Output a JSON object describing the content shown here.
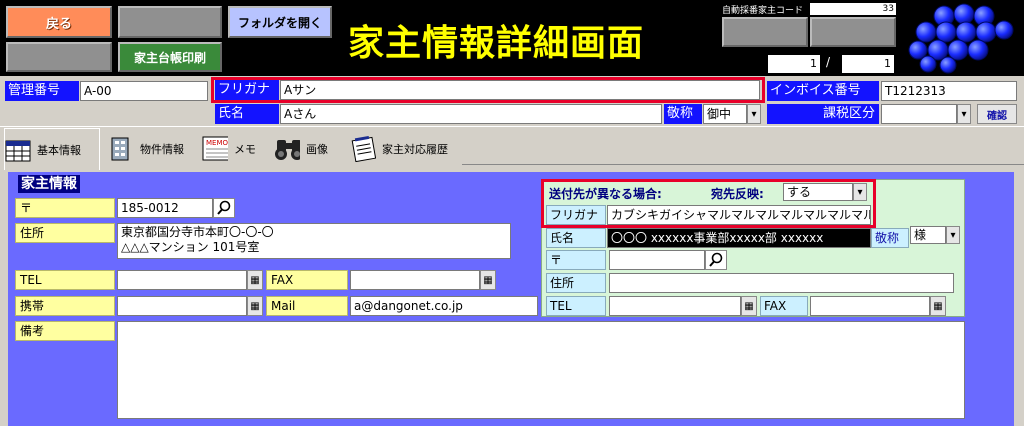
{
  "header": {
    "back_label": "戻る",
    "folder_label": "フォルダを開く",
    "print_label": "家主台帳印刷",
    "title": "家主情報詳細画面",
    "auto_code_label": "自動採番家主コード",
    "auto_code_value": "33",
    "record_current": "1",
    "record_separator": "/",
    "record_total": "1"
  },
  "top": {
    "management_no_label": "管理番号",
    "management_no_value": "A-00",
    "furigana_label": "フリガナ",
    "furigana_value": "Aサン",
    "name_label": "氏名",
    "name_value": "Aさん",
    "honorific_label": "敬称",
    "honorific_value": "御中",
    "invoice_label": "インボイス番号",
    "invoice_value": "T1212313",
    "tax_label": "課税区分",
    "tax_value": "",
    "confirm_label": "確認"
  },
  "tabs": [
    {
      "label": "基本情報",
      "icon": "calendar-icon"
    },
    {
      "label": "物件情報",
      "icon": "building-icon"
    },
    {
      "label": "メモ",
      "icon": "memo-icon"
    },
    {
      "label": "画像",
      "icon": "binoculars-icon"
    },
    {
      "label": "家主対応履歴",
      "icon": "notepad-icon"
    }
  ],
  "panel": {
    "section_title": "家主情報",
    "zip_label": "〒",
    "zip_value": "185-0012",
    "address_label": "住所",
    "address_line1": "東京都国分寺市本町〇-〇-〇",
    "address_line2": "△△△マンション 101号室",
    "tel_label": "TEL",
    "tel_value": "",
    "fax_label": "FAX",
    "fax_value": "",
    "mobile_label": "携帯",
    "mobile_value": "",
    "mail_label": "Mail",
    "mail_value": "a@dangonet.co.jp",
    "notes_label": "備考",
    "notes_value": ""
  },
  "alt_dest": {
    "header_label": "送付先が異なる場合:",
    "reflect_label": "宛先反映:",
    "reflect_value": "する",
    "furigana_label": "フリガナ",
    "furigana_value": "カブシキガイシャマルマルマルマルマルマルマル",
    "name_label": "氏名",
    "name_value": "〇〇〇 xxxxxx事業部xxxxx部 xxxxxx",
    "honorific_label": "敬称",
    "honorific_value": "様",
    "zip_label": "〒",
    "zip_value": "",
    "address_label": "住所",
    "address_value": "",
    "tel_label": "TEL",
    "tel_value": "",
    "fax_label": "FAX",
    "fax_value": ""
  },
  "colors": {
    "header_bg": "#000000",
    "title": "#ffff00",
    "label_blue": "#1313ff",
    "panel": "#6a6aff",
    "highlight": "#e8002a",
    "logo": "#1a2cff"
  }
}
